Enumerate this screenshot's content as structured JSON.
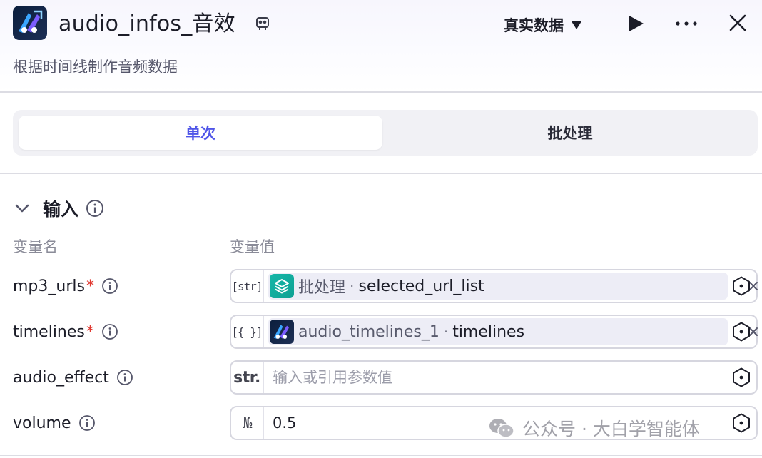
{
  "header": {
    "title": "audio_infos_音效",
    "subtitle": "根据时间线制作音频数据",
    "data_mode": "真实数据"
  },
  "tabs": [
    {
      "label": "单次",
      "active": true
    },
    {
      "label": "批处理",
      "active": false
    }
  ],
  "input_section": {
    "title": "输入",
    "col_name": "变量名",
    "col_value": "变量值",
    "rows": [
      {
        "name": "mp3_urls",
        "required": "*",
        "type": "[str]",
        "source": "批处理",
        "sep": "·",
        "variable": "selected_url_list"
      },
      {
        "name": "timelines",
        "required": "*",
        "type": "[{ }]",
        "source": "audio_timelines_1",
        "sep": "·",
        "variable": "timelines"
      },
      {
        "name": "audio_effect",
        "type": "str.",
        "placeholder": "输入或引用参数值",
        "value": ""
      },
      {
        "name": "volume",
        "type": "№",
        "placeholder": "",
        "value": "0.5"
      }
    ]
  },
  "watermark": "公众号 · 大白学智能体",
  "colors": {
    "accent": "#4f55e8",
    "required": "#e0372f",
    "teal_icon": "#16b7a8"
  }
}
